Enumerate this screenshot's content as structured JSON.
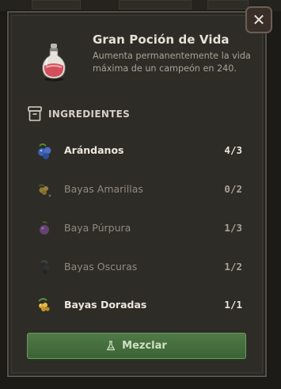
{
  "title": "Gran Poción de Vida",
  "description": "Aumenta permanentemente la vida máxima de un campeón en 240.",
  "section_label": "INGREDIENTES",
  "ingredients": [
    {
      "name": "Arándanos",
      "count": "4/3",
      "icon": "blueberries-icon",
      "available": true
    },
    {
      "name": "Bayas Amarillas",
      "count": "0/2",
      "icon": "yellow-berries-icon",
      "available": false
    },
    {
      "name": "Baya Púrpura",
      "count": "1/3",
      "icon": "purple-berry-icon",
      "available": false
    },
    {
      "name": "Bayas Oscuras",
      "count": "1/2",
      "icon": "dark-berries-icon",
      "available": false
    },
    {
      "name": "Bayas Doradas",
      "count": "1/1",
      "icon": "golden-berries-icon",
      "available": true
    }
  ],
  "mix_button_label": "Mezclar",
  "close_symbol": "✕",
  "colors": {
    "panel": "#2d2c27",
    "accent_green": "#4f7a45",
    "text": "#e6e1d6"
  }
}
